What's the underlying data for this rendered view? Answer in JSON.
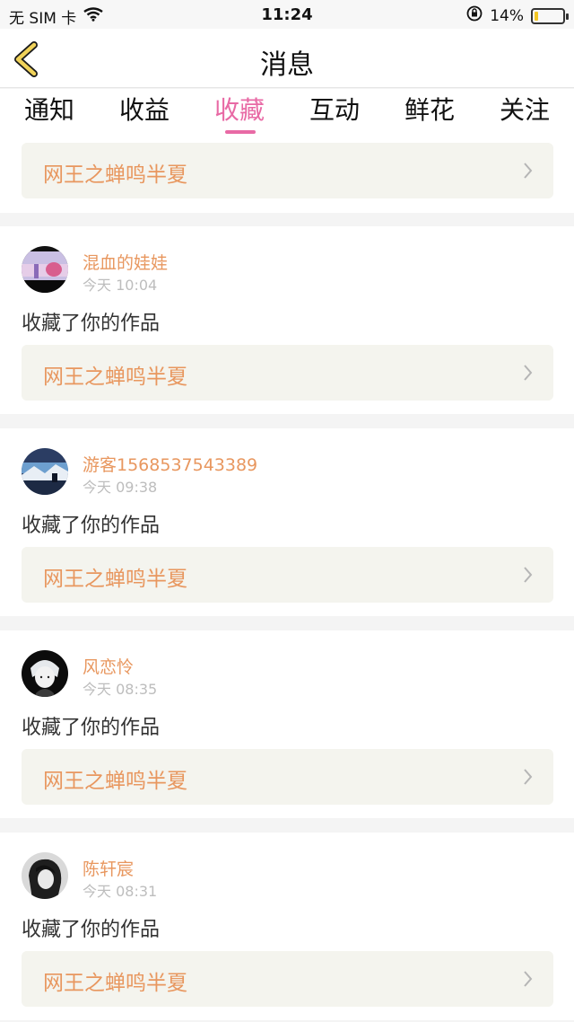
{
  "status_bar": {
    "carrier": "无 SIM 卡",
    "time": "11:24",
    "battery": "14%",
    "battery_level": 0.14
  },
  "nav": {
    "title": "消息"
  },
  "tabs": [
    {
      "label": "通知",
      "active": false
    },
    {
      "label": "收益",
      "active": false
    },
    {
      "label": "收藏",
      "active": true
    },
    {
      "label": "互动",
      "active": false
    },
    {
      "label": "鲜花",
      "active": false
    },
    {
      "label": "关注",
      "active": false
    }
  ],
  "first_item": {
    "work_title": "网王之蝉鸣半夏"
  },
  "items": [
    {
      "username": "混血的娃娃",
      "time": "今天 10:04",
      "action": "收藏了你的作品",
      "work_title": "网王之蝉鸣半夏"
    },
    {
      "username": "游客1568537543389",
      "time": "今天 09:38",
      "action": "收藏了你的作品",
      "work_title": "网王之蝉鸣半夏"
    },
    {
      "username": "风恋怜",
      "time": "今天 08:35",
      "action": "收藏了你的作品",
      "work_title": "网王之蝉鸣半夏"
    },
    {
      "username": "陈轩宸",
      "time": "今天 08:31",
      "action": "收藏了你的作品",
      "work_title": "网王之蝉鸣半夏"
    }
  ],
  "colors": {
    "accent_pink": "#e86aa5",
    "username_orange": "#e8975f",
    "back_arrow": "#f0d25a"
  }
}
